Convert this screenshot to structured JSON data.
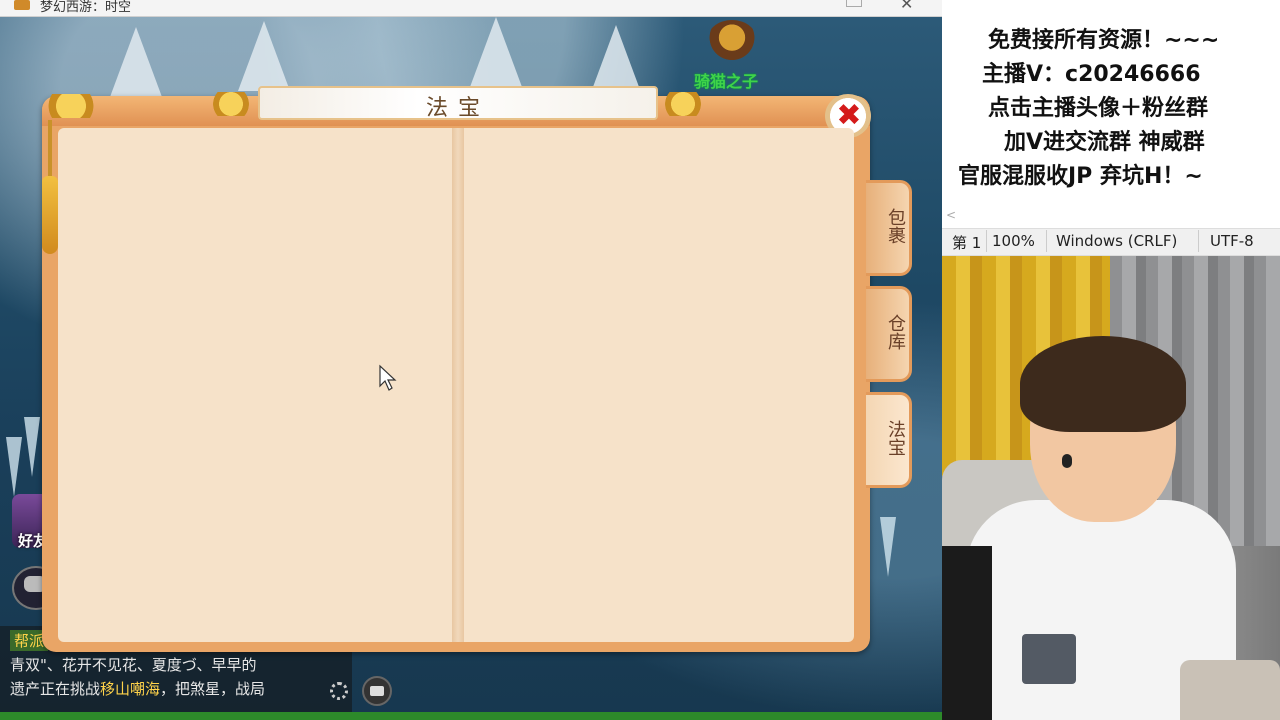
{
  "window": {
    "title": "梦幻西游：时空",
    "close_glyph": "✕"
  },
  "game": {
    "npc_label": "骑猫之子",
    "hud": {
      "friend_label": "好友",
      "chat_tag": "帮派",
      "chat_lines": [
        "青双\"、花开不见花、夏度づ、早早的",
        "遗产正在挑战移山嘲海，把煞星，战局"
      ],
      "chat_highlight": "移山嘲海"
    }
  },
  "dialog": {
    "title": "法宝",
    "close_glyph": "✖",
    "tabs": [
      {
        "label": "包裹",
        "active": false
      },
      {
        "label": "仓库",
        "active": false
      },
      {
        "label": "法宝",
        "active": true
      }
    ]
  },
  "stream": {
    "overlay_lines": [
      "免费接所有资源！~~~",
      "主播V：c20246666",
      "点击主播头像＋粉丝群",
      "加V进交流群 神威群",
      "官服混服收JP    弃坑H！~"
    ],
    "scroll_arrow": "<",
    "statusbar": {
      "line": "第 1",
      "zoom": "100%",
      "eol": "Windows (CRLF)",
      "encoding": "UTF-8"
    }
  },
  "colors": {
    "dialog_frame": "#e9a566",
    "page": "#f6e2c9",
    "close_red": "#d41a1a",
    "npc_green": "#3fd34a"
  }
}
